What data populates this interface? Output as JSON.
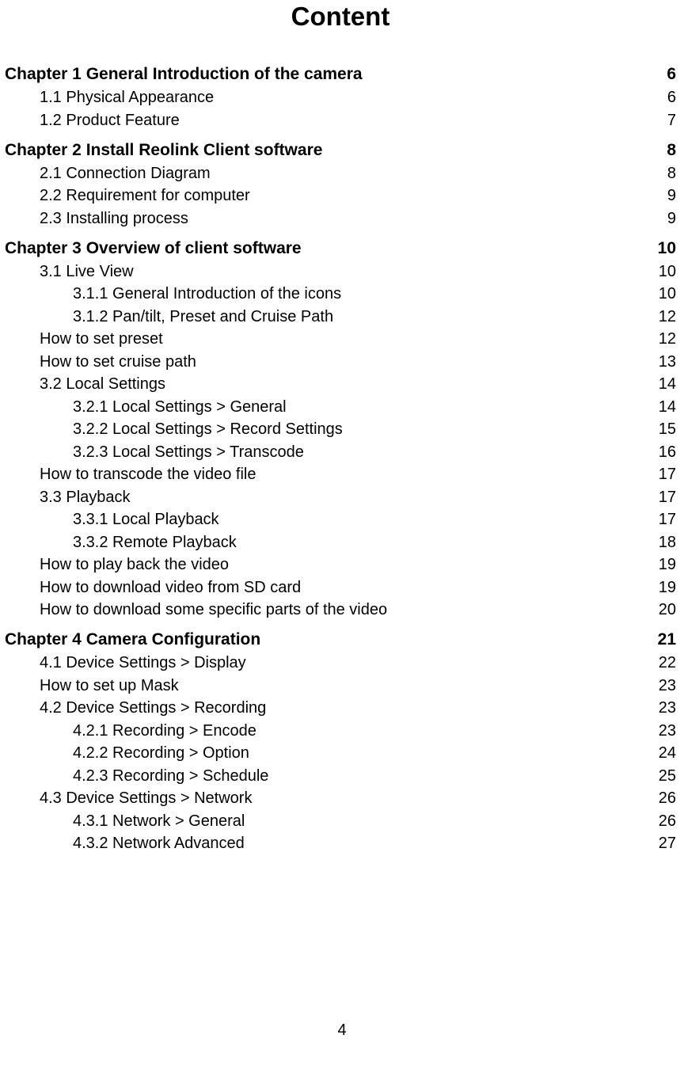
{
  "title": "Content",
  "page_number": "4",
  "entries": [
    {
      "level": "chapter",
      "label": "Chapter 1 General Introduction of the camera",
      "page": "6"
    },
    {
      "level": "sub",
      "label": "1.1 Physical Appearance",
      "page": "6"
    },
    {
      "level": "sub",
      "label": "1.2 Product Feature",
      "page": "7"
    },
    {
      "level": "chapter",
      "label": "Chapter 2 Install Reolink Client software",
      "page": "8"
    },
    {
      "level": "sub",
      "label": "2.1 Connection Diagram",
      "page": "8"
    },
    {
      "level": "sub",
      "label": "2.2 Requirement for computer",
      "page": "9"
    },
    {
      "level": "sub",
      "label": "2.3 Installing process",
      "page": "9"
    },
    {
      "level": "chapter",
      "label": "Chapter 3 Overview of client software",
      "page": "10"
    },
    {
      "level": "sub",
      "label": "3.1 Live View",
      "page": "10"
    },
    {
      "level": "subsub",
      "label": "3.1.1 General Introduction of the icons",
      "page": "10"
    },
    {
      "level": "subsub",
      "label": "3.1.2 Pan/tilt, Preset and Cruise Path",
      "page": "12"
    },
    {
      "level": "sub",
      "label": "How to set preset",
      "page": "12"
    },
    {
      "level": "sub",
      "label": "How to set cruise path",
      "page": "13"
    },
    {
      "level": "sub",
      "label": "3.2 Local Settings",
      "page": "14"
    },
    {
      "level": "subsub",
      "label": "3.2.1 Local Settings > General",
      "page": "14"
    },
    {
      "level": "subsub",
      "label": "3.2.2 Local Settings > Record Settings",
      "page": "15"
    },
    {
      "level": "subsub",
      "label": "3.2.3 Local Settings > Transcode",
      "page": "16"
    },
    {
      "level": "sub",
      "label": "How to transcode the video file",
      "page": "17"
    },
    {
      "level": "sub",
      "label": "3.3 Playback",
      "page": "17"
    },
    {
      "level": "subsub",
      "label": "3.3.1 Local Playback",
      "page": "17"
    },
    {
      "level": "subsub",
      "label": "3.3.2 Remote Playback",
      "page": "18"
    },
    {
      "level": "sub",
      "label": "How to play back the video",
      "page": "19"
    },
    {
      "level": "sub",
      "label": "How to download video from SD card",
      "page": "19"
    },
    {
      "level": "sub",
      "label": "How to download some specific parts of the video",
      "page": "20"
    },
    {
      "level": "chapter",
      "label": "Chapter 4 Camera Configuration",
      "page": "21"
    },
    {
      "level": "sub",
      "label": "4.1 Device Settings > Display",
      "page": "22"
    },
    {
      "level": "sub",
      "label": "How to set up Mask",
      "page": "23"
    },
    {
      "level": "sub",
      "label": "4.2 Device Settings > Recording",
      "page": "23"
    },
    {
      "level": "subsub",
      "label": "4.2.1 Recording > Encode",
      "page": "23"
    },
    {
      "level": "subsub",
      "label": "4.2.2 Recording > Option",
      "page": "24"
    },
    {
      "level": "subsub",
      "label": "4.2.3 Recording > Schedule",
      "page": "25"
    },
    {
      "level": "sub",
      "label": "4.3 Device Settings > Network",
      "page": "26"
    },
    {
      "level": "subsub",
      "label": "4.3.1 Network > General",
      "page": "26"
    },
    {
      "level": "subsub",
      "label": "4.3.2 Network Advanced",
      "page": "27"
    }
  ]
}
